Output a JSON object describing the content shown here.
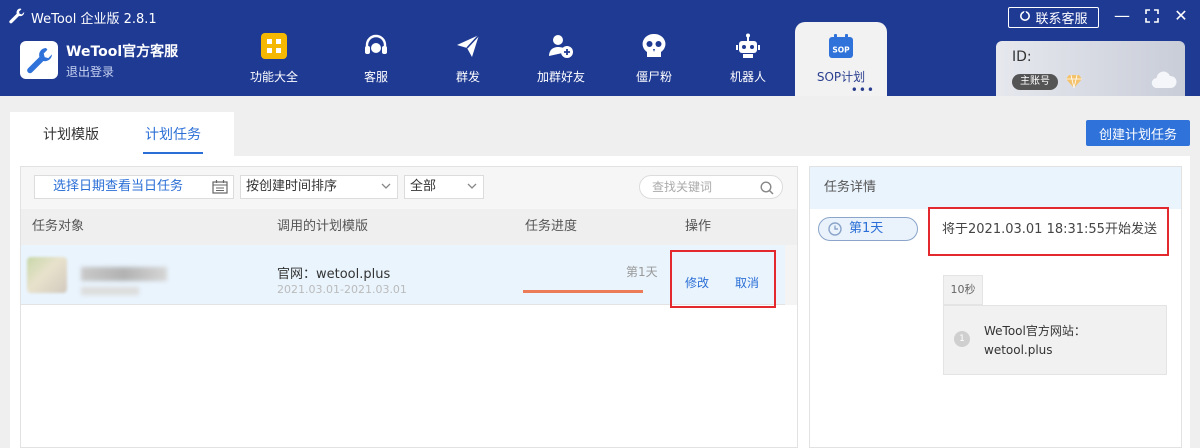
{
  "window": {
    "title": "WeTool 企业版 2.8.1",
    "support_button": "联系客服"
  },
  "account": {
    "name": "WeTool官方客服",
    "logout": "退出登录",
    "id_label": "ID:",
    "badge": "主账号"
  },
  "nav": [
    {
      "label": "功能大全",
      "icon": "grid-icon"
    },
    {
      "label": "客服",
      "icon": "headset-icon"
    },
    {
      "label": "群发",
      "icon": "send-icon"
    },
    {
      "label": "加群好友",
      "icon": "add-friend-icon"
    },
    {
      "label": "僵尸粉",
      "icon": "skull-icon"
    },
    {
      "label": "机器人",
      "icon": "robot-icon"
    },
    {
      "label": "SOP计划",
      "icon": "sop-calendar-icon",
      "icon_text": "SOP",
      "active": true,
      "more": "•••"
    }
  ],
  "tabs": {
    "template": "计划模版",
    "task": "计划任务"
  },
  "create_button": "创建计划任务",
  "filters": {
    "date_picker": "选择日期查看当日任务",
    "sort": "按创建时间排序",
    "status": "全部",
    "search_placeholder": "查找关键词"
  },
  "table": {
    "headers": [
      "任务对象",
      "调用的计划模版",
      "任务进度",
      "操作"
    ],
    "rows": [
      {
        "template_name": "官网：wetool.plus",
        "date_range": "2021.03.01-2021.03.01",
        "progress_label": "第1天",
        "progress": 1.0,
        "edit": "修改",
        "cancel": "取消"
      }
    ]
  },
  "detail": {
    "title": "任务详情",
    "day": "第1天",
    "send_info": "将于2021.03.01 18:31:55开始发送",
    "delay": "10秒",
    "message_index": "1",
    "message": "WeTool官方网站：wetool.plus"
  },
  "colors": {
    "header_bg": "#1f3a93",
    "accent": "#2b6fd6",
    "highlight_red": "#e4292e",
    "progress": "#ec7c57"
  }
}
